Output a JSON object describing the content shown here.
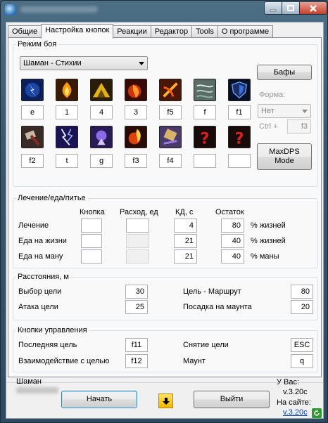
{
  "window": {
    "min_icon": "minimize-icon",
    "max_icon": "maximize-icon",
    "close_icon": "close-icon"
  },
  "tabs": [
    {
      "label": "Общие"
    },
    {
      "label": "Настройка кнопок"
    },
    {
      "label": "Реакции"
    },
    {
      "label": "Редактор"
    },
    {
      "label": "Tools"
    },
    {
      "label": "О программе"
    }
  ],
  "active_tab": 1,
  "mode": {
    "legend": "Режим боя",
    "combo_value": "Шаман - Стихии",
    "buffs_button": "Бафы",
    "form_label": "Форма:",
    "form_value": "Нет",
    "ctrl_label": "Ctrl +",
    "ctrl_key": "f3",
    "maxdps_line1": "MaxDPS",
    "maxdps_line2": "Mode",
    "row1_keys": [
      "e",
      "1",
      "4",
      "3",
      "f5",
      "f",
      "f1"
    ],
    "row2_keys": [
      "f2",
      "t",
      "g",
      "f3",
      "f4",
      "",
      ""
    ],
    "row1_icons": [
      "lightning-shield-icon",
      "fire-nova-icon",
      "earth-totem-icon",
      "flame-shock-icon",
      "fire-totem-icon",
      "wind-totem-icon",
      "water-shield-icon"
    ],
    "row2_icons": [
      "weapon-enchant-icon",
      "chain-lightning-icon",
      "ghost-wolf-icon",
      "lava-burst-icon",
      "earth-shock-icon",
      "unknown-ability-icon",
      "unknown-ability-icon"
    ]
  },
  "healing": {
    "legend": "Лечение/еда/питье",
    "headers": {
      "button": "Кнопка",
      "cost": "Расход, ед",
      "cd": "КД, с",
      "threshold": "Остаток"
    },
    "rows": [
      {
        "label": "Лечение",
        "button": "",
        "cost": "",
        "cd": "4",
        "threshold": "80",
        "unit": "% жизней"
      },
      {
        "label": "Еда на жизни",
        "button": "",
        "cost": "",
        "cd": "21",
        "threshold": "40",
        "unit": "% жизней"
      },
      {
        "label": "Еда на ману",
        "button": "",
        "cost": "",
        "cd": "21",
        "threshold": "40",
        "unit": "% маны"
      }
    ]
  },
  "distance": {
    "legend": "Расстояния, м",
    "target_select_label": "Выбор цели",
    "target_select_value": "30",
    "attack_label": "Атака цели",
    "attack_value": "25",
    "route_label": "Цель - Маршрут",
    "route_value": "80",
    "mount_land_label": "Посадка на маунта",
    "mount_land_value": "20"
  },
  "controls": {
    "legend": "Кнопки управления",
    "last_target_label": "Последняя цель",
    "last_target_key": "f11",
    "interact_label": "Взаимодействие с целью",
    "interact_key": "f12",
    "clear_target_label": "Снятие цели",
    "clear_target_key": "ESC",
    "mount_label": "Маунт",
    "mount_key": "q"
  },
  "footer": {
    "class_name": "Шаман",
    "start_button": "Начать",
    "exit_button": "Выйти",
    "you_have_label": "У Вас:",
    "you_have_version": "v.3.20c",
    "on_site_label": "На сайте:",
    "on_site_version": "v.3.20c",
    "arrow_icon": "down-arrow-icon",
    "refresh_icon": "refresh-icon"
  }
}
